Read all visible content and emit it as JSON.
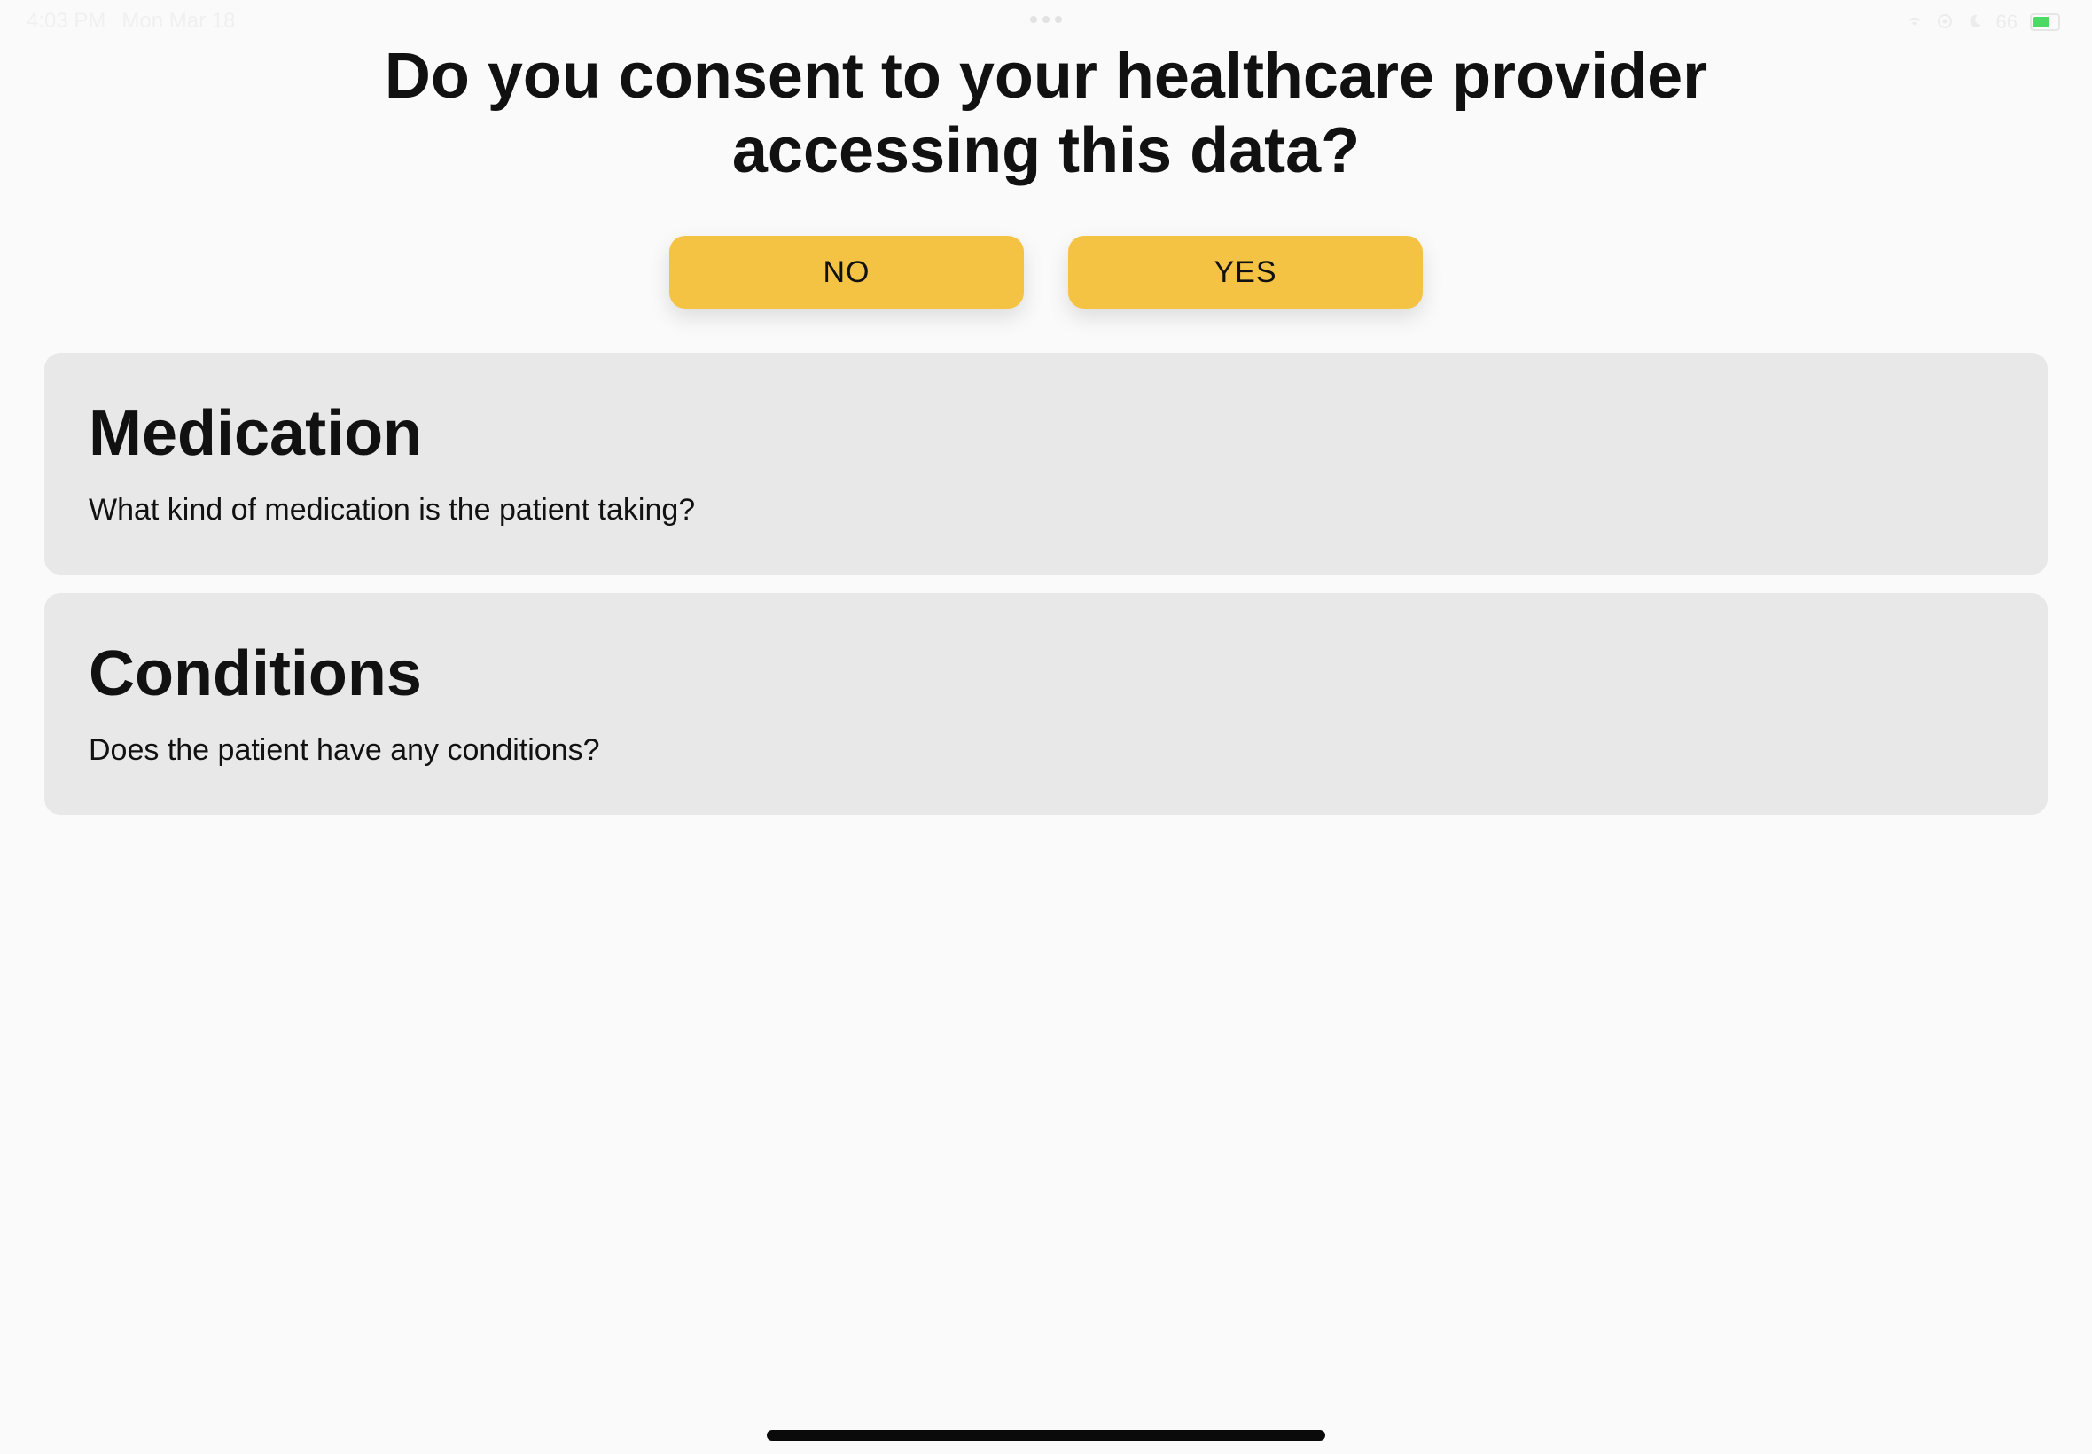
{
  "status_bar": {
    "time": "4:03 PM",
    "date": "Mon Mar 18",
    "battery_percent": "66",
    "icons": [
      "wifi-icon",
      "location-icon",
      "moon-icon"
    ],
    "battery_color": "#4cd964"
  },
  "consent": {
    "question": "Do you consent to your healthcare provider accessing this data?",
    "no_label": "NO",
    "yes_label": "YES",
    "button_color": "#f4c344"
  },
  "cards": [
    {
      "title": "Medication",
      "description": "What kind of medication is the patient taking?"
    },
    {
      "title": "Conditions",
      "description": "Does the patient have any conditions?"
    }
  ]
}
